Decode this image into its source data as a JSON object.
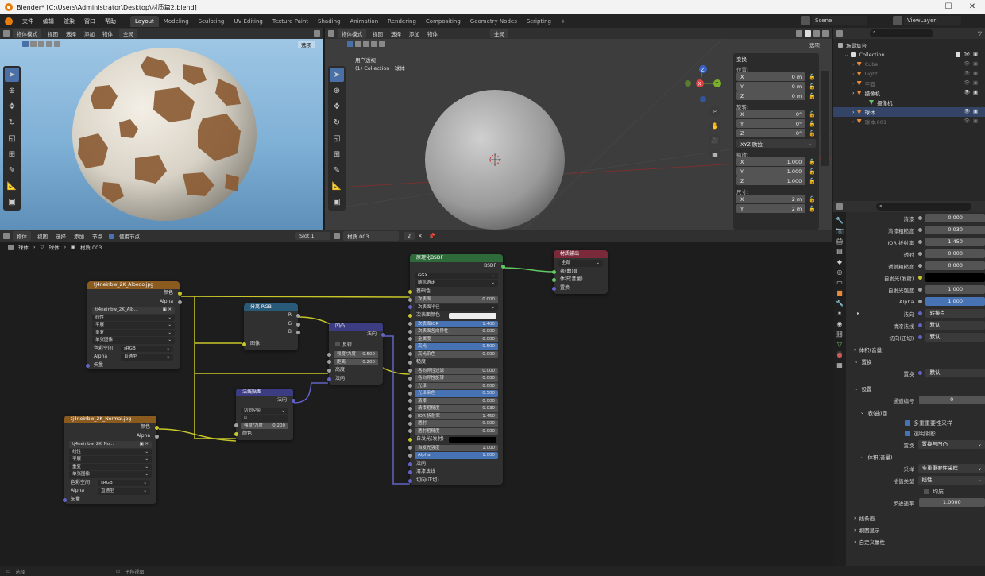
{
  "window": {
    "title": "Blender* [C:\\Users\\Administrator\\Desktop\\材质篇2.blend]"
  },
  "menu": {
    "items": [
      "文件",
      "编辑",
      "渲染",
      "窗口",
      "帮助"
    ],
    "workspaces": [
      "Layout",
      "Modeling",
      "Sculpting",
      "UV Editing",
      "Texture Paint",
      "Shading",
      "Animation",
      "Rendering",
      "Compositing",
      "Geometry Nodes",
      "Scripting"
    ],
    "scene": "Scene",
    "view_layer": "ViewLayer"
  },
  "viewport_left": {
    "mode": "物体模式",
    "menus": [
      "视图",
      "选择",
      "添加",
      "物体"
    ],
    "transform": "全局",
    "options": "选项"
  },
  "viewport_right": {
    "mode": "物体模式",
    "menus": [
      "视图",
      "选择",
      "添加",
      "物体"
    ],
    "transform": "全局",
    "options": "选项",
    "overlay_line1": "用户透视",
    "overlay_line2": "(1) Collection | 球体"
  },
  "npanel": {
    "title": "变换",
    "location_label": "位置:",
    "location": [
      "0 m",
      "0 m",
      "0 m"
    ],
    "rotation_label": "旋转:",
    "rotation": [
      "0°",
      "0°",
      "0°"
    ],
    "rotation_mode": "XYZ 欧拉",
    "scale_label": "缩放:",
    "scale": [
      "1.000",
      "1.000",
      "1.000"
    ],
    "dims_label": "尺寸:",
    "dims": [
      "2 m",
      "2 m"
    ],
    "axes": [
      "X",
      "Y",
      "Z"
    ]
  },
  "outliner": {
    "root": "场景集合",
    "collection": "Collection",
    "items": [
      {
        "name": "Cube",
        "dim": true
      },
      {
        "name": "Light",
        "dim": true
      },
      {
        "name": "平面",
        "dim": true
      },
      {
        "name": "摄像机",
        "dim": false
      },
      {
        "name": "摄像机",
        "dim": false,
        "child": true
      },
      {
        "name": "球体",
        "dim": false
      },
      {
        "name": "球体.001",
        "dim": true
      }
    ]
  },
  "node_editor": {
    "mode": "物体",
    "menus": [
      "视图",
      "选择",
      "添加",
      "节点"
    ],
    "use_nodes": "使用节点",
    "slot": "Slot 1",
    "material": "材质.003",
    "users": "2",
    "breadcrumb": [
      "球体",
      "球体",
      "材质.003"
    ]
  },
  "nodes": {
    "albedo": {
      "title": "tj4neinbw_2K_Albedo.jpg",
      "out": [
        "颜色",
        "Alpha"
      ],
      "file": "tj4neinbw_2K_Alb...",
      "opts": [
        "线性",
        "平展",
        "重复",
        "单张图像"
      ],
      "cs_label": "色彩空间",
      "cs": "sRGB",
      "alpha_label": "Alpha",
      "alpha": "直通型",
      "vec": "矢量"
    },
    "normal_img": {
      "title": "tj4neinbw_2K_Normal.jpg",
      "out": [
        "颜色",
        "Alpha"
      ],
      "file": "tj4neinbw_2K_No...",
      "opts": [
        "线性",
        "平展",
        "重复",
        "单张图像"
      ],
      "cs_label": "色彩空间",
      "cs": "sRGB",
      "alpha_label": "Alpha",
      "alpha": "直通型",
      "vec": "矢量"
    },
    "sep": {
      "title": "分离 RGB",
      "out": [
        "R",
        "G",
        "B"
      ],
      "in": "图像"
    },
    "bump": {
      "title": "凹凸",
      "out": "法向",
      "invert": "反转",
      "strength_label": "强度/力度",
      "strength": "0.500",
      "dist_label": "距离",
      "dist": "0.200",
      "h": "高度",
      "n": "法向"
    },
    "nmap": {
      "title": "法线贴图",
      "out": "法向",
      "space": "切向空间",
      "strength_label": "强度/力度",
      "strength": "0.200",
      "color": "颜色"
    },
    "bsdf": {
      "title": "原理化BSDF",
      "out": "BSDF",
      "dist": "GGX",
      "sss": "随机游走",
      "rows": [
        {
          "l": "基础色",
          "t": "sock"
        },
        {
          "l": "次表面",
          "v": "0.000"
        },
        {
          "l": "次表面半径",
          "t": "sel"
        },
        {
          "l": "次表面颜色",
          "t": "white"
        },
        {
          "l": "次表面IOR",
          "v": "1.400",
          "hl": true
        },
        {
          "l": "次表面各向异性",
          "v": "0.000"
        },
        {
          "l": "金属度",
          "v": "0.000"
        },
        {
          "l": "高光",
          "v": "0.500",
          "hl": true
        },
        {
          "l": "高光染色",
          "v": "0.000"
        },
        {
          "l": "糙度",
          "t": "sock"
        },
        {
          "l": "各向异性过滤",
          "v": "0.000"
        },
        {
          "l": "各向异性旋转",
          "v": "0.000"
        },
        {
          "l": "光泽",
          "v": "0.000"
        },
        {
          "l": "光泽染色",
          "v": "0.500",
          "hl": true
        },
        {
          "l": "清漆",
          "v": "0.000"
        },
        {
          "l": "清漆粗糙度",
          "v": "0.030"
        },
        {
          "l": "IOR 折射率",
          "v": "1.450"
        },
        {
          "l": "透射",
          "v": "0.000"
        },
        {
          "l": "透射粗糙度",
          "v": "0.000"
        },
        {
          "l": "自发光(发射)",
          "t": "black"
        },
        {
          "l": "自发光强度",
          "v": "1.000"
        },
        {
          "l": "Alpha",
          "v": "1.000",
          "hl": true
        },
        {
          "l": "法向",
          "t": "sock"
        },
        {
          "l": "清漆法线",
          "t": "sock"
        },
        {
          "l": "切向(正切)",
          "t": "sock"
        }
      ]
    },
    "output": {
      "title": "材质输出",
      "target": "全部",
      "in": [
        "表(曲)面",
        "体积(音量)",
        "置换"
      ]
    }
  },
  "props": {
    "rows": [
      {
        "l": "清漆",
        "v": "0.000"
      },
      {
        "l": "清漆粗糙度",
        "v": "0.030"
      },
      {
        "l": "IOR 折射率",
        "v": "1.450"
      },
      {
        "l": "透射",
        "v": "0.000"
      },
      {
        "l": "透射粗糙度",
        "v": "0.000"
      },
      {
        "l": "自发光(发射)",
        "t": "black"
      },
      {
        "l": "自发光强度",
        "v": "1.000"
      },
      {
        "l": "Alpha",
        "v": "1.000",
        "hl": true
      },
      {
        "l": "法向",
        "v": "转接点",
        "t": "link"
      },
      {
        "l": "清漆法线",
        "v": "默认",
        "t": "link"
      },
      {
        "l": "切向(正切)",
        "v": "默认",
        "t": "link"
      }
    ],
    "volume": "体积(音量)",
    "disp_section": "置换",
    "disp_label": "置换",
    "disp_value": "默认",
    "settings": "设置",
    "pass_label": "通道编号",
    "pass_value": "0",
    "surface": "表(曲)面",
    "multi_importance": "多重重要性采样",
    "transparent_shadow": "透明阴影",
    "disp_method_label": "置换",
    "disp_method": "置换与凹凸",
    "vol_section": "体积(音量)",
    "sampling_label": "采样",
    "sampling": "多重重要性采样",
    "interp_label": "插值类型",
    "interp": "线性",
    "homogeneous": "均质",
    "step_label": "步进速率",
    "step": "1.0000",
    "line_art": "线条画",
    "viewport_display": "视图显示",
    "custom_props": "自定义属性"
  },
  "status": {
    "left": "选择",
    "mid": "平移视图"
  }
}
